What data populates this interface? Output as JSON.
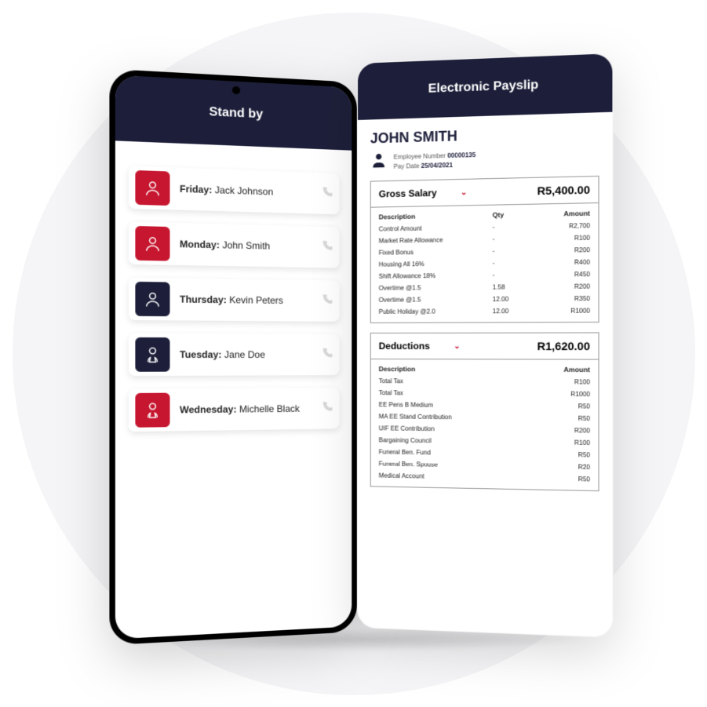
{
  "phone1": {
    "title": "Stand by",
    "items": [
      {
        "day": "Friday:",
        "name": "Jack Johnson",
        "color": "red",
        "icon": "male"
      },
      {
        "day": "Monday:",
        "name": "John Smith",
        "color": "red",
        "icon": "male"
      },
      {
        "day": "Thursday:",
        "name": "Kevin Peters",
        "color": "navy",
        "icon": "male"
      },
      {
        "day": "Tuesday:",
        "name": "Jane Doe",
        "color": "navy",
        "icon": "female"
      },
      {
        "day": "Wednesday:",
        "name": "Michelle Black",
        "color": "red",
        "icon": "female"
      }
    ]
  },
  "phone2": {
    "title": "Electronic Payslip",
    "employee": {
      "name": "JOHN SMITH",
      "emp_no_label": "Employee Number",
      "emp_no": "00000135",
      "pay_date_label": "Pay Date",
      "pay_date": "25/04/2021"
    },
    "gross": {
      "title": "Gross Salary",
      "total": "R5,400.00",
      "headers": {
        "c1": "Description",
        "c2": "Qty",
        "c3": "Amount"
      },
      "rows": [
        {
          "desc": "Control Amount",
          "qty": "-",
          "amt": "R2,700"
        },
        {
          "desc": "Market Rate Allowance",
          "qty": "-",
          "amt": "R100"
        },
        {
          "desc": "Fixed Bonus",
          "qty": "-",
          "amt": "R200"
        },
        {
          "desc": "Housing All 16%",
          "qty": "-",
          "amt": "R400"
        },
        {
          "desc": "Shift Allowance 18%",
          "qty": "-",
          "amt": "R450"
        },
        {
          "desc": "Overtime @1.5",
          "qty": "1.58",
          "amt": "R200"
        },
        {
          "desc": "Overtime @1.5",
          "qty": "12.00",
          "amt": "R350"
        },
        {
          "desc": "Public Holiday @2.0",
          "qty": "12.00",
          "amt": "R1000"
        }
      ]
    },
    "deductions": {
      "title": "Deductions",
      "total": "R1,620.00",
      "headers": {
        "c1": "Description",
        "c3": "Amount"
      },
      "rows": [
        {
          "desc": "Total Tax",
          "amt": "R100"
        },
        {
          "desc": "Total Tax",
          "amt": "R1000"
        },
        {
          "desc": "EE Pens B Medium",
          "amt": "R50"
        },
        {
          "desc": "MA EE Stand Contribution",
          "amt": "R50"
        },
        {
          "desc": "UIF EE Contribution",
          "amt": "R200"
        },
        {
          "desc": "Bargaining Council",
          "amt": "R100"
        },
        {
          "desc": "Funeral Ben. Fund",
          "amt": "R50"
        },
        {
          "desc": "Funeral Ben. Spouse",
          "amt": "R20"
        },
        {
          "desc": "Medical Account",
          "amt": "R50"
        }
      ]
    }
  }
}
